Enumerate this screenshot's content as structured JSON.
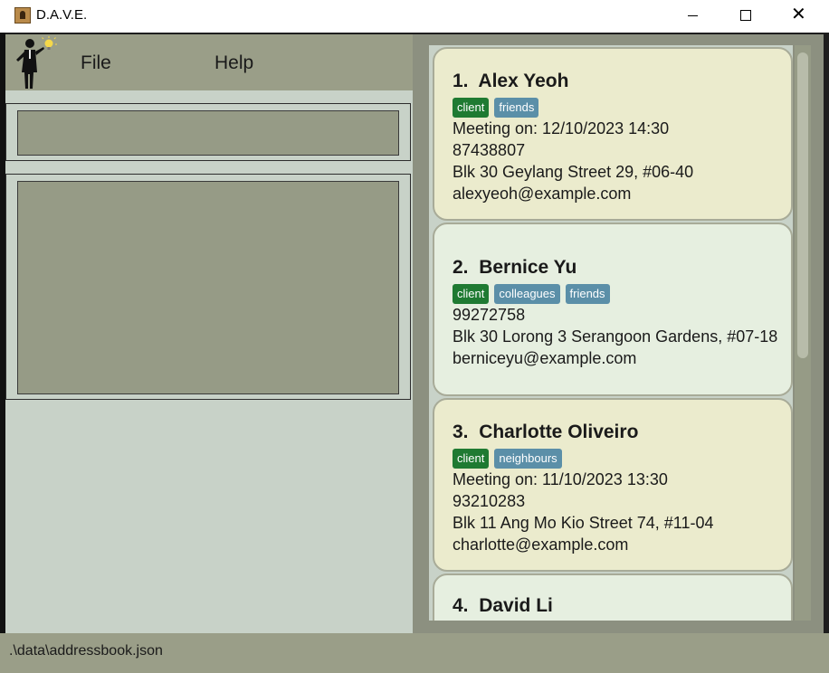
{
  "window": {
    "title": "D.A.V.E.",
    "controls": {
      "minimize": "minimize",
      "maximize": "maximize",
      "close": "✕"
    }
  },
  "menu": {
    "file": "File",
    "help": "Help"
  },
  "command": {
    "value": ""
  },
  "result": {
    "text": ""
  },
  "persons": [
    {
      "index": "1.",
      "name": "Alex Yeoh",
      "tags": [
        "client",
        "friends"
      ],
      "meeting": "Meeting on: 12/10/2023 14:30",
      "phone": "87438807",
      "address": "Blk 30 Geylang Street 29, #06-40",
      "email": "alexyeoh@example.com"
    },
    {
      "index": "2.",
      "name": "Bernice Yu",
      "tags": [
        "client",
        "colleagues",
        "friends"
      ],
      "meeting": "",
      "phone": "99272758",
      "address": "Blk 30 Lorong 3 Serangoon Gardens, #07-18",
      "email": "berniceyu@example.com"
    },
    {
      "index": "3.",
      "name": "Charlotte Oliveiro",
      "tags": [
        "client",
        "neighbours"
      ],
      "meeting": "Meeting on: 11/10/2023 13:30",
      "phone": "93210283",
      "address": "Blk 11 Ang Mo Kio Street 74, #11-04",
      "email": "charlotte@example.com"
    },
    {
      "index": "4.",
      "name": "David Li",
      "tags": [],
      "meeting": "",
      "phone": "",
      "address": "",
      "email": ""
    }
  ],
  "status": {
    "path": ".\\data\\addressbook.json"
  },
  "colors": {
    "menubar": "#9a9e88",
    "pane": "#c8d2c8",
    "card_odd": "#ebebcd",
    "card_even": "#e6efe0",
    "tag_client": "#1f7a32",
    "tag_other": "#5b8fa8"
  },
  "icons": {
    "app": "person-icon",
    "logo": "butler-lightbulb-logo"
  }
}
